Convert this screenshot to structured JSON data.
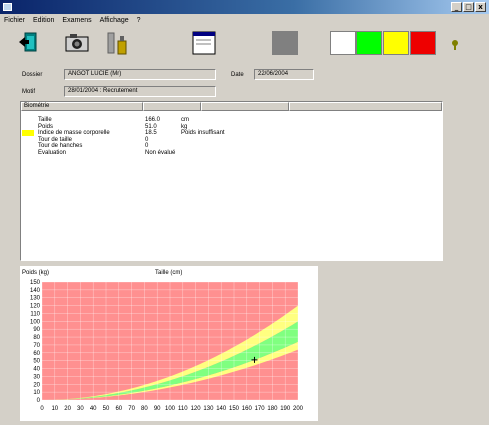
{
  "window": {
    "min_label": "_",
    "max_label": "□",
    "close_label": "x"
  },
  "menu": [
    "Fichier",
    "Edition",
    "Examens",
    "Affichage",
    "?"
  ],
  "toolbar": {
    "swatches": [
      {
        "name": "white",
        "color": "#ffffff"
      },
      {
        "name": "green",
        "color": "#00ff00"
      },
      {
        "name": "yellow",
        "color": "#ffff00"
      },
      {
        "name": "red",
        "color": "#ee0000"
      }
    ],
    "gray_square_color": "#808080",
    "icons": [
      "exit-icon",
      "camera-icon",
      "bottle-icon",
      "window-icon",
      "help-icon"
    ]
  },
  "patient": {
    "dossier_label": "Dossier",
    "dossier_value": "ANGOT LUCIE (Mr)",
    "date_label": "Date",
    "date_value": "22/06/2004",
    "motif_label": "Motif",
    "motif_value": "28/01/2004 : Recrutement"
  },
  "table": {
    "columns": [
      "Biométrie",
      "",
      "",
      ""
    ],
    "rows": [
      {
        "flag": "",
        "label": "Taille",
        "value": "166.0",
        "unit": "cm"
      },
      {
        "flag": "",
        "label": "Poids",
        "value": "51.0",
        "unit": "kg"
      },
      {
        "flag": "#ffff00",
        "label": "Indice de masse corporelle",
        "value": "18.5",
        "unit": "Poids insuffisant"
      },
      {
        "flag": "",
        "label": "Tour de taille",
        "value": "0",
        "unit": ""
      },
      {
        "flag": "",
        "label": "Tour de hanches",
        "value": "0",
        "unit": ""
      },
      {
        "flag": "",
        "label": "Evaluation",
        "value": "Non évalué",
        "unit": ""
      }
    ]
  },
  "chart_data": {
    "type": "area",
    "title": "",
    "ylabel": "Poids (kg)",
    "xlabel": "Taille (cm)",
    "xlim": [
      0,
      200
    ],
    "ylim": [
      0,
      150
    ],
    "x_ticks": [
      0,
      10,
      20,
      30,
      40,
      50,
      60,
      70,
      80,
      90,
      100,
      110,
      120,
      130,
      140,
      150,
      160,
      170,
      180,
      190,
      200
    ],
    "y_ticks": [
      0,
      10,
      20,
      30,
      40,
      50,
      60,
      70,
      80,
      90,
      100,
      110,
      120,
      130,
      140,
      150
    ],
    "grid": true,
    "bands": [
      {
        "name": "underweight",
        "color": "#ffff80",
        "bmi_low": 16,
        "bmi_high": 18.5
      },
      {
        "name": "normal",
        "color": "#80ff80",
        "bmi_low": 18.5,
        "bmi_high": 25
      },
      {
        "name": "overweight",
        "color": "#ffff80",
        "bmi_low": 25,
        "bmi_high": 30
      }
    ],
    "background_color": "#ff9090",
    "point": {
      "x": 166,
      "y": 51
    }
  }
}
